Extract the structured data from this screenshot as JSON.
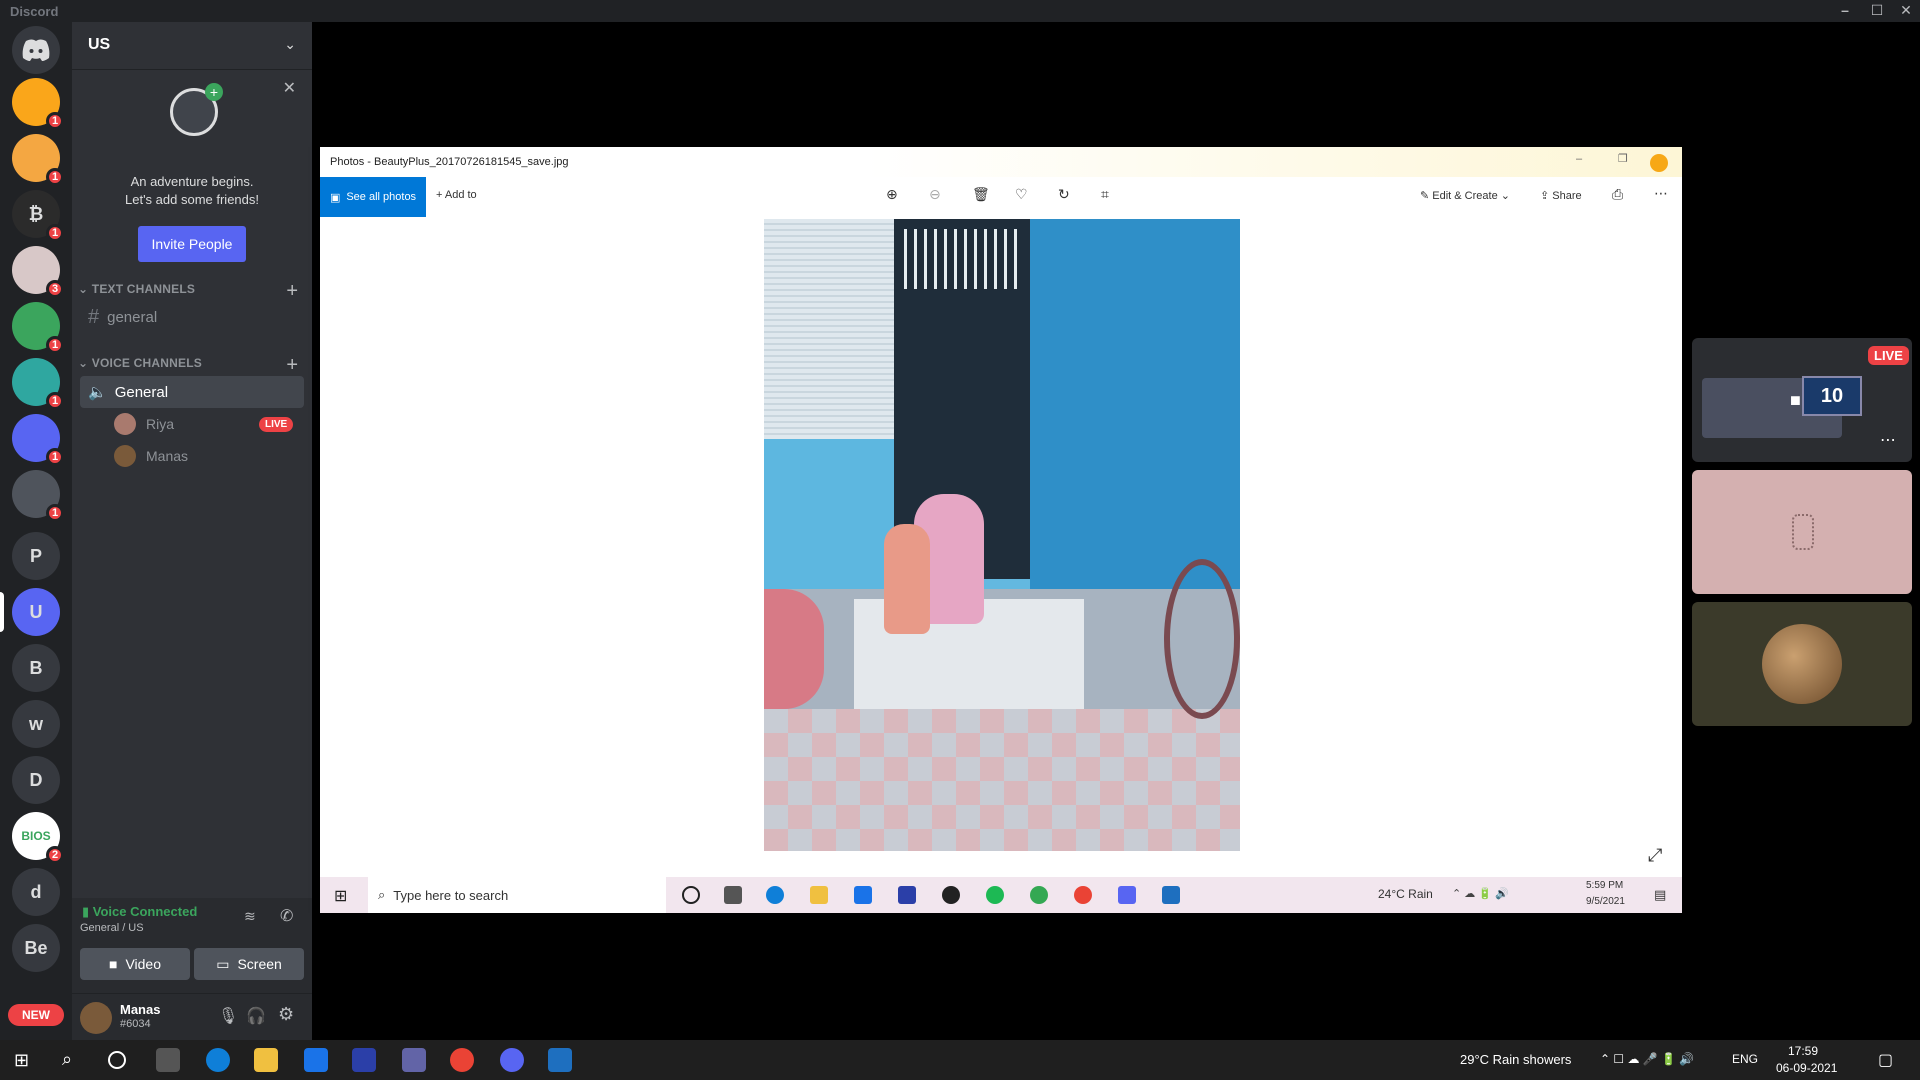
{
  "window": {
    "title": "Discord",
    "controls": [
      "minimize-icon",
      "maximize-icon",
      "close-icon"
    ]
  },
  "rail": {
    "servers": [
      {
        "name": "server-1",
        "letter": "",
        "color": "#faa61a",
        "badge": "1"
      },
      {
        "name": "server-2",
        "letter": "",
        "color": "#f4a742",
        "badge": "1"
      },
      {
        "name": "server-3",
        "letter": "₿",
        "color": "#2b2b2b",
        "badge": "1"
      },
      {
        "name": "server-4",
        "letter": "",
        "color": "#d8c8c8",
        "badge": "3"
      },
      {
        "name": "server-5",
        "letter": "",
        "color": "#3ba55d",
        "badge": "1"
      },
      {
        "name": "server-6",
        "letter": "",
        "color": "#2fa7a0",
        "badge": "1"
      },
      {
        "name": "server-7",
        "letter": "",
        "color": "#5865f2",
        "badge": "1"
      },
      {
        "name": "server-8",
        "letter": "",
        "color": "#4f545c",
        "badge": "1"
      },
      {
        "name": "server-p",
        "letter": "P",
        "color": "#36393f",
        "badge": ""
      },
      {
        "name": "server-u",
        "letter": "U",
        "color": "#5865f2",
        "badge": ""
      },
      {
        "name": "server-b",
        "letter": "B",
        "color": "#36393f",
        "badge": ""
      },
      {
        "name": "server-w",
        "letter": "w",
        "color": "#36393f",
        "badge": ""
      },
      {
        "name": "server-d",
        "letter": "D",
        "color": "#36393f",
        "badge": ""
      },
      {
        "name": "server-bios",
        "letter": "BIOS",
        "color": "#ffffff",
        "badge": "2"
      },
      {
        "name": "server-d2",
        "letter": "d",
        "color": "#36393f",
        "badge": ""
      },
      {
        "name": "server-be",
        "letter": "Be",
        "color": "#36393f",
        "badge": ""
      }
    ],
    "new_label": "NEW"
  },
  "sidebar": {
    "guild_name": "US",
    "invite": {
      "line1": "An adventure begins.",
      "line2": "Let's add some friends!",
      "button": "Invite People"
    },
    "text_section": "TEXT CHANNELS",
    "text_channels": [
      "general"
    ],
    "voice_section": "VOICE CHANNELS",
    "voice_channel": "General",
    "voice_users": [
      {
        "name": "Riya",
        "live": "LIVE"
      },
      {
        "name": "Manas",
        "live": ""
      }
    ],
    "voice_status": {
      "title": "Voice Connected",
      "subtitle": "General / US",
      "video": "Video",
      "screen": "Screen"
    },
    "user": {
      "name": "Manas",
      "tag": "#6034"
    }
  },
  "photos": {
    "title": "Photos - BeautyPlus_20170726181545_save.jpg",
    "see_all": "See all photos",
    "add_to": "Add to",
    "edit_create": "Edit & Create",
    "share": "Share",
    "taskbar": {
      "search": "Type here to search",
      "weather": "24°C  Rain",
      "time": "5:59 PM",
      "date": "9/5/2021"
    }
  },
  "stream": {
    "live": "LIVE",
    "counter": "10"
  },
  "taskbar": {
    "weather": "29°C  Rain showers",
    "lang": "ENG",
    "time": "17:59",
    "date": "06-09-2021"
  }
}
